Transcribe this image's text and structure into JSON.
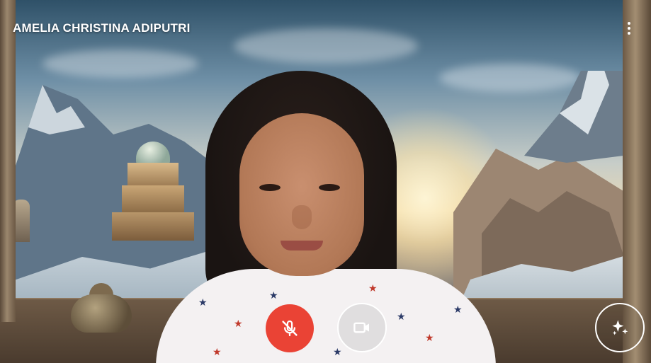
{
  "participant": {
    "name": "AMELIA CHRISTINA ADIPUTRI"
  },
  "controls": {
    "more_options_icon": "more-vert-icon",
    "microphone": {
      "icon": "mic-off-icon",
      "state": "muted",
      "color": "#ea4335"
    },
    "camera": {
      "icon": "videocam-icon",
      "state": "on"
    },
    "effects": {
      "icon": "sparkle-icon"
    }
  },
  "background": {
    "description_colors": {
      "sky": "#6e8fa6",
      "sun": "#fff6d6",
      "stone": "#8c755c"
    }
  }
}
